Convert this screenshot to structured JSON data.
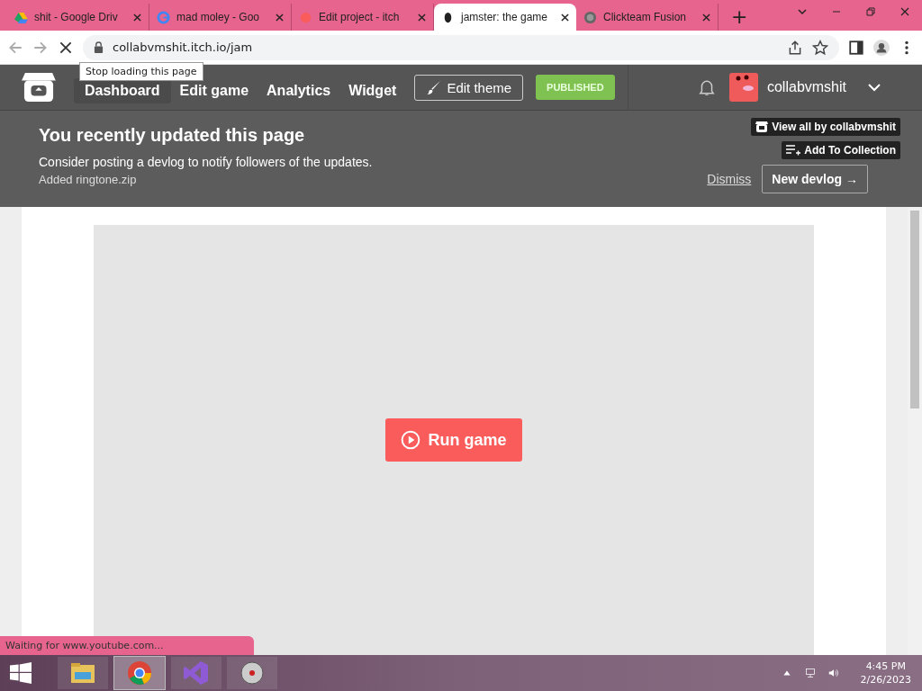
{
  "browser": {
    "tabs": [
      {
        "title": "shit - Google Driv",
        "selected": false
      },
      {
        "title": "mad moley - Goo",
        "selected": false
      },
      {
        "title": "Edit project - itch",
        "selected": false
      },
      {
        "title": "jamster: the game",
        "selected": true
      },
      {
        "title": "Clickteam Fusion",
        "selected": false
      }
    ],
    "new_tab": "+",
    "url": "collabvmshit.itch.io/jam",
    "tooltip": "Stop loading this page",
    "status": "Waiting for www.youtube.com..."
  },
  "nav": {
    "links": [
      {
        "label": "Dashboard",
        "selected": true
      },
      {
        "label": "Edit game",
        "selected": false
      },
      {
        "label": "Analytics",
        "selected": false
      },
      {
        "label": "Widget",
        "selected": false
      }
    ],
    "edit_theme": "Edit theme",
    "status_badge": "PUBLISHED",
    "username": "collabvmshit"
  },
  "notice": {
    "title": "You recently updated this page",
    "message": "Consider posting a devlog to notify followers of the updates.",
    "detail": "Added ringtone.zip",
    "view_all": "View all by collabvmshit",
    "add_to_collection": "Add To Collection",
    "dismiss": "Dismiss",
    "new_devlog": "New devlog →"
  },
  "game": {
    "run_button": "Run game"
  },
  "taskbar": {
    "apps": [
      {
        "selected": false
      },
      {
        "selected": true
      },
      {
        "selected": false
      },
      {
        "selected": false
      }
    ],
    "time": "4:45 PM",
    "date": "2/26/2023"
  }
}
